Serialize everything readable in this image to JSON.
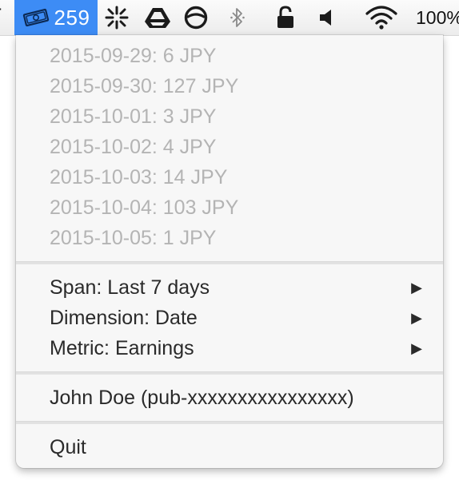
{
  "menubar": {
    "status_item": {
      "icon": "money-icon",
      "count": "259"
    },
    "icons": [
      "asterisk-grid-icon",
      "drive-icon",
      "no-entry-circle-icon",
      "bluetooth-icon",
      "lock-icon",
      "volume-icon",
      "wifi-icon"
    ],
    "battery_text": "100%",
    "colors": {
      "highlight": "#3d8cf5",
      "disabled_text": "#b4b4b4",
      "menu_bg": "#f7f7f7"
    }
  },
  "menu": {
    "earnings": [
      "2015-09-29: 6 JPY",
      "2015-09-30: 127 JPY",
      "2015-10-01: 3 JPY",
      "2015-10-02: 4 JPY",
      "2015-10-03: 14 JPY",
      "2015-10-04: 103 JPY",
      "2015-10-05: 1 JPY"
    ],
    "span_label": "Span: Last 7 days",
    "dimension_label": "Dimension: Date",
    "metric_label": "Metric: Earnings",
    "submenu_arrow": "▶",
    "account_label": "John Doe (pub-xxxxxxxxxxxxxxxx)",
    "quit_label": "Quit"
  }
}
